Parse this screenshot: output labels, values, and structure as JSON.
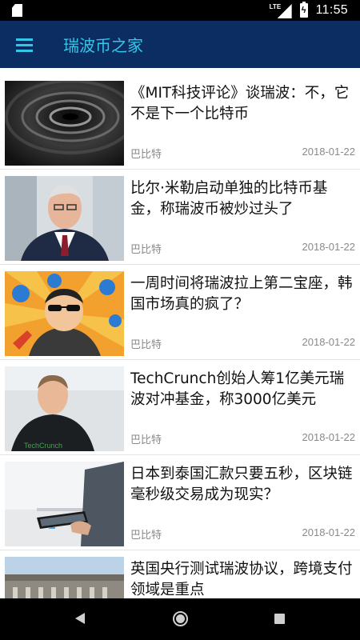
{
  "status_bar": {
    "network": "LTE",
    "time": "11:55",
    "battery_icon": "battery-charging-icon"
  },
  "app_bar": {
    "title": "瑞波币之家",
    "menu_icon": "hamburger-menu-icon"
  },
  "colors": {
    "app_bar_bg": "#0c2d62",
    "accent": "#34c6e8",
    "meta_text": "#8a8a8a"
  },
  "articles": [
    {
      "title": "《MIT科技评论》谈瑞波：不，它不是下一个比特币",
      "source": "巴比特",
      "date": "2018-01-22",
      "thumbnail": "water-ripple-image"
    },
    {
      "title": "比尔·米勒启动单独的比特币基金，称瑞波币被炒过头了",
      "source": "巴比特",
      "date": "2018-01-22",
      "thumbnail": "man-in-suit-portrait-image"
    },
    {
      "title": "一周时间将瑞波拉上第二宝座，韩国市场真的疯了？",
      "source": "巴比特",
      "date": "2018-01-22",
      "thumbnail": "cartoon-sunglasses-man-image"
    },
    {
      "title": "TechCrunch创始人筹1亿美元瑞波对冲基金，称3000亿美元",
      "source": "巴比特",
      "date": "2018-01-22",
      "thumbnail": "techcrunch-founder-photo-image"
    },
    {
      "title": "日本到泰国汇款只要五秒，区块链毫秒级交易成为现实？",
      "source": "巴比特",
      "date": "2018-01-22",
      "thumbnail": "hand-holding-tablet-image"
    },
    {
      "title": "英国央行测试瑞波协议，跨境支付领域是重点",
      "source": "",
      "date": "",
      "thumbnail": "bank-of-england-building-image"
    }
  ],
  "nav_bar": {
    "back": "back-icon",
    "home": "home-icon",
    "recents": "recents-icon"
  }
}
